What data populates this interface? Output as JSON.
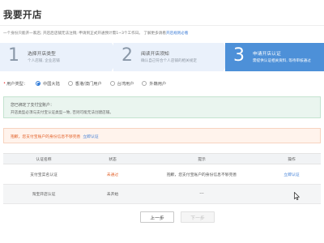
{
  "page": {
    "title": "我要开店",
    "subtitle": "一个身份只能开一家店; 开店后店铺无法注销; 申请到正式开通预计需1~3个工作日。 了解更多请看",
    "subtitle_link": "开店规则必看"
  },
  "steps": [
    {
      "num": "1",
      "title": "选择开店类型",
      "desc": "个人店铺, 企业店铺"
    },
    {
      "num": "2",
      "title": "阅读开店须知",
      "desc": "确认自己符合个人店铺的相关规定"
    },
    {
      "num": "3",
      "title": "申请开店认证",
      "desc": "需提供认证相关资料, 等待审核通过"
    }
  ],
  "user_type": {
    "label": "用户类型：",
    "options": [
      "中国大陆",
      "香港/澳门用户",
      "台湾用户",
      "外籍用户"
    ],
    "selected_index": 0
  },
  "info": {
    "line1": "您已绑定了支付宝账户：",
    "line2": "开店类型必须与支付宝认证类型一致, 否则可能无法创建店铺。"
  },
  "warning": {
    "text": "抱歉，您支付宝账户的身份信息不够完善",
    "link": "立即认证"
  },
  "table": {
    "headers": [
      "认证名称",
      "状态",
      "提示",
      "操作"
    ],
    "rows": [
      {
        "name": "支付宝实名认证",
        "status": "未通过",
        "tip": "抱歉，您支付宝账户的身份信息不够完善",
        "op": "立即认证"
      },
      {
        "name": "淘宝开店认证",
        "status": "未开始",
        "tip": "---",
        "op": ""
      }
    ]
  },
  "buttons": {
    "prev": "上一步",
    "next": "下一步"
  },
  "colors": {
    "accent": "#4d90d8",
    "link": "#3a7bd5",
    "warning_text": "#e2622a",
    "info_bg": "#eaf5ef",
    "warning_bg": "#fff3ec"
  }
}
